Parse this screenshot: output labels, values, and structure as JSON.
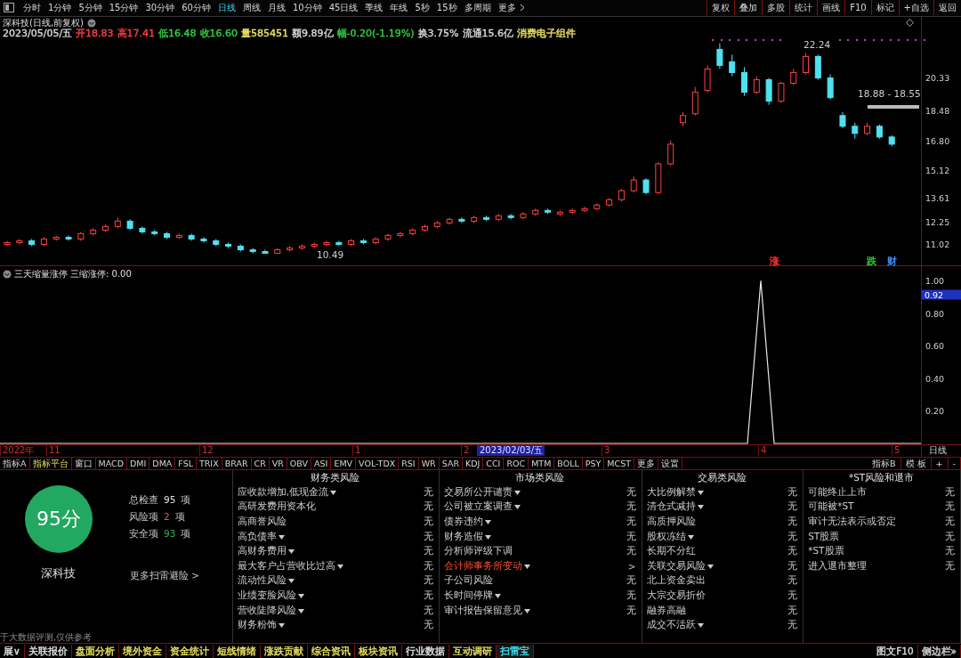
{
  "toolbar": {
    "periods": [
      {
        "label": "分时",
        "selected": false
      },
      {
        "label": "1分钟",
        "selected": false
      },
      {
        "label": "5分钟",
        "selected": false
      },
      {
        "label": "15分钟",
        "selected": false
      },
      {
        "label": "30分钟",
        "selected": false
      },
      {
        "label": "60分钟",
        "selected": false
      },
      {
        "label": "日线",
        "selected": true
      },
      {
        "label": "周线",
        "selected": false
      },
      {
        "label": "月线",
        "selected": false
      },
      {
        "label": "10分钟",
        "selected": false
      },
      {
        "label": "45日线",
        "selected": false
      },
      {
        "label": "季线",
        "selected": false
      },
      {
        "label": "年线",
        "selected": false
      },
      {
        "label": "5秒",
        "selected": false
      },
      {
        "label": "15秒",
        "selected": false
      },
      {
        "label": "多周期",
        "selected": false
      },
      {
        "label": "更多",
        "selected": false
      }
    ],
    "actions": [
      "复权",
      "叠加",
      "多股",
      "统计",
      "画线",
      "F10",
      "标记",
      "+自选",
      "返回"
    ]
  },
  "chart": {
    "title": "深科技(日线,前复权)",
    "quote": [
      {
        "text": "2023/05/05/五",
        "color": "#d8d8d8"
      },
      {
        "text": "开18.83",
        "color": "#ff4040"
      },
      {
        "text": "高17.41",
        "color": "#ff4040"
      },
      {
        "text": "低16.48",
        "color": "#30d040"
      },
      {
        "text": "收16.60",
        "color": "#30d040"
      },
      {
        "text": "量585451",
        "color": "#e8e060"
      },
      {
        "text": "额9.89亿",
        "color": "#d8d8d8"
      },
      {
        "text": "幅-0.20(-1.19%)",
        "color": "#30d040"
      },
      {
        "text": "换3.75%",
        "color": "#d8d8d8"
      },
      {
        "text": "流通15.6亿",
        "color": "#d8d8d8"
      },
      {
        "text": "消费电子组件",
        "color": "#e8e060"
      }
    ],
    "chart_data": {
      "type": "candlestick",
      "ylim": [
        9.83,
        23.71
      ],
      "yticks": [
        {
          "value": 20.33,
          "label": "20.33"
        },
        {
          "value": 18.48,
          "label": "18.48"
        },
        {
          "value": 16.8,
          "label": "16.80"
        },
        {
          "value": 15.12,
          "label": "15.12"
        },
        {
          "value": 13.61,
          "label": "13.61"
        },
        {
          "value": 12.25,
          "label": "12.25"
        },
        {
          "value": 11.02,
          "label": "11.02"
        }
      ],
      "ohlc": [
        [
          11.0,
          11.2,
          10.9,
          11.1
        ],
        [
          11.1,
          11.3,
          11.0,
          11.2
        ],
        [
          11.2,
          11.3,
          10.9,
          11.0
        ],
        [
          11.0,
          11.4,
          10.9,
          11.3
        ],
        [
          11.3,
          11.5,
          11.2,
          11.4
        ],
        [
          11.4,
          11.5,
          11.2,
          11.3
        ],
        [
          11.3,
          11.7,
          11.2,
          11.6
        ],
        [
          11.6,
          11.9,
          11.5,
          11.8
        ],
        [
          11.8,
          12.1,
          11.7,
          12.0
        ],
        [
          12.0,
          12.5,
          11.9,
          12.3
        ],
        [
          12.3,
          12.4,
          11.8,
          11.9
        ],
        [
          11.9,
          12.0,
          11.6,
          11.7
        ],
        [
          11.7,
          11.8,
          11.5,
          11.6
        ],
        [
          11.6,
          11.7,
          11.3,
          11.4
        ],
        [
          11.4,
          11.6,
          11.3,
          11.5
        ],
        [
          11.5,
          11.6,
          11.2,
          11.3
        ],
        [
          11.3,
          11.4,
          11.1,
          11.2
        ],
        [
          11.2,
          11.3,
          10.9,
          11.0
        ],
        [
          11.0,
          11.1,
          10.8,
          10.9
        ],
        [
          10.9,
          11.0,
          10.6,
          10.7
        ],
        [
          10.7,
          10.8,
          10.49,
          10.6
        ],
        [
          10.6,
          10.7,
          10.49,
          10.5
        ],
        [
          10.5,
          10.8,
          10.5,
          10.7
        ],
        [
          10.7,
          10.9,
          10.6,
          10.8
        ],
        [
          10.8,
          11.0,
          10.7,
          10.9
        ],
        [
          10.9,
          11.1,
          10.8,
          11.0
        ],
        [
          11.0,
          11.2,
          10.9,
          11.1
        ],
        [
          11.1,
          11.2,
          10.9,
          11.0
        ],
        [
          11.0,
          11.3,
          10.9,
          11.2
        ],
        [
          11.2,
          11.3,
          11.0,
          11.1
        ],
        [
          11.1,
          11.4,
          11.0,
          11.3
        ],
        [
          11.3,
          11.6,
          11.2,
          11.5
        ],
        [
          11.5,
          11.7,
          11.4,
          11.6
        ],
        [
          11.6,
          11.9,
          11.5,
          11.8
        ],
        [
          11.8,
          12.1,
          11.7,
          12.0
        ],
        [
          12.0,
          12.3,
          11.9,
          12.2
        ],
        [
          12.2,
          12.5,
          12.1,
          12.4
        ],
        [
          12.4,
          12.5,
          12.2,
          12.3
        ],
        [
          12.3,
          12.6,
          12.2,
          12.5
        ],
        [
          12.5,
          12.6,
          12.3,
          12.4
        ],
        [
          12.4,
          12.7,
          12.3,
          12.6
        ],
        [
          12.6,
          12.7,
          12.4,
          12.5
        ],
        [
          12.5,
          12.8,
          12.4,
          12.7
        ],
        [
          12.7,
          13.0,
          12.6,
          12.9
        ],
        [
          12.9,
          13.0,
          12.7,
          12.8
        ],
        [
          12.7,
          12.9,
          12.6,
          12.8
        ],
        [
          12.8,
          13.0,
          12.7,
          12.9
        ],
        [
          12.9,
          13.1,
          12.8,
          13.0
        ],
        [
          13.0,
          13.3,
          12.9,
          13.2
        ],
        [
          13.2,
          13.6,
          13.1,
          13.5
        ],
        [
          13.5,
          14.1,
          13.4,
          14.0
        ],
        [
          14.0,
          14.8,
          13.9,
          14.6
        ],
        [
          14.6,
          14.7,
          13.8,
          13.9
        ],
        [
          13.9,
          15.6,
          13.8,
          15.5
        ],
        [
          15.5,
          16.8,
          15.4,
          16.6
        ],
        [
          17.8,
          18.4,
          17.6,
          18.2
        ],
        [
          18.3,
          19.8,
          18.2,
          19.5
        ],
        [
          19.6,
          21.0,
          19.5,
          20.8
        ],
        [
          21.9,
          22.24,
          20.8,
          21.0
        ],
        [
          21.2,
          21.6,
          20.4,
          20.6
        ],
        [
          20.6,
          20.9,
          19.3,
          19.5
        ],
        [
          19.5,
          20.4,
          19.4,
          20.2
        ],
        [
          20.2,
          20.3,
          18.8,
          19.0
        ],
        [
          19.0,
          20.1,
          18.9,
          20.0
        ],
        [
          20.0,
          20.8,
          19.9,
          20.6
        ],
        [
          20.6,
          21.7,
          20.5,
          21.5
        ],
        [
          21.5,
          21.6,
          20.2,
          20.3
        ],
        [
          20.3,
          20.5,
          19.1,
          19.2
        ],
        [
          18.2,
          18.4,
          17.5,
          17.6
        ],
        [
          17.6,
          17.8,
          16.9,
          17.2
        ],
        [
          17.2,
          17.8,
          17.1,
          17.6
        ],
        [
          17.6,
          17.7,
          16.9,
          17.0
        ],
        [
          17.0,
          17.1,
          16.48,
          16.6
        ]
      ]
    },
    "high_label": "22.24",
    "low_label": "10.49",
    "range_label": "18.88 - 18.55",
    "markers": [
      {
        "text": "涨",
        "color": "#ff3030"
      },
      {
        "text": "跌",
        "color": "#30c030"
      },
      {
        "text": "财",
        "color": "#4090ff"
      }
    ]
  },
  "indicator": {
    "title": "三天缩量涨停",
    "readout": ": 0.00",
    "cursor_value": "0.92",
    "chart_data": {
      "type": "line",
      "ylim": [
        0,
        1.09
      ],
      "yticks": [
        {
          "value": 0.2,
          "label": "0.20"
        },
        {
          "value": 0.4,
          "label": "0.40"
        },
        {
          "value": 0.6,
          "label": "0.60"
        },
        {
          "value": 0.8,
          "label": "0.80"
        },
        {
          "value": 1,
          "label": "1.00"
        }
      ],
      "series": [
        {
          "name": "三缩涨停",
          "color": "#e8e8e8",
          "values": [
            0,
            0,
            0,
            0,
            0,
            0,
            0,
            0,
            0,
            0,
            0,
            0,
            0,
            0,
            0,
            0,
            0,
            0,
            0,
            0,
            0,
            0,
            0,
            0,
            0,
            0,
            0,
            0,
            0,
            0,
            0,
            0,
            0,
            0,
            0,
            0,
            0,
            0,
            0,
            0,
            0,
            0,
            0,
            0,
            0,
            0,
            0,
            0,
            0,
            0,
            0,
            0,
            0,
            0,
            0,
            0,
            0,
            1,
            0,
            0,
            0,
            0,
            0,
            0,
            0,
            0,
            0,
            0,
            0,
            0
          ]
        }
      ]
    }
  },
  "date_axis": {
    "labels": [
      {
        "text": "2022年",
        "selected": false
      },
      {
        "text": "11",
        "selected": false
      },
      {
        "text": "12",
        "selected": false
      },
      {
        "text": "1",
        "selected": false
      },
      {
        "text": "2",
        "selected": false
      },
      {
        "text": "2023/02/03/五",
        "selected": true
      },
      {
        "text": "3",
        "selected": false
      },
      {
        "text": "4",
        "selected": false
      },
      {
        "text": "5",
        "selected": false
      }
    ],
    "period": "日线"
  },
  "indicator_tabs": [
    {
      "label": "指标A",
      "selected": false
    },
    {
      "label": "指标平台",
      "selected": true
    },
    {
      "label": "窗口",
      "selected": false
    },
    {
      "label": "MACD",
      "selected": false
    },
    {
      "label": "DMI",
      "selected": false
    },
    {
      "label": "DMA",
      "selected": false
    },
    {
      "label": "FSL",
      "selected": false
    },
    {
      "label": "TRIX",
      "selected": false
    },
    {
      "label": "BRAR",
      "selected": false
    },
    {
      "label": "CR",
      "selected": false
    },
    {
      "label": "VR",
      "selected": false
    },
    {
      "label": "OBV",
      "selected": false
    },
    {
      "label": "ASI",
      "selected": false
    },
    {
      "label": "EMV",
      "selected": false
    },
    {
      "label": "VOL-TDX",
      "selected": false
    },
    {
      "label": "RSI",
      "selected": false
    },
    {
      "label": "WR",
      "selected": false
    },
    {
      "label": "SAR",
      "selected": false
    },
    {
      "label": "KDJ",
      "selected": false
    },
    {
      "label": "CCI",
      "selected": false
    },
    {
      "label": "ROC",
      "selected": false
    },
    {
      "label": "MTM",
      "selected": false
    },
    {
      "label": "BOLL",
      "selected": false
    },
    {
      "label": "PSY",
      "selected": false
    },
    {
      "label": "MCST",
      "selected": false
    },
    {
      "label": "更多",
      "selected": false
    },
    {
      "label": "设置",
      "selected": false
    }
  ],
  "indicator_tools": [
    "指标B",
    "模 板",
    "+",
    "-"
  ],
  "summary": {
    "score": "95分",
    "stock": "深科技",
    "stats": [
      {
        "label": "总检查",
        "value": "95",
        "unit": "项",
        "color": "#e0e0e0"
      },
      {
        "label": "风险项",
        "value": "2",
        "unit": "项",
        "color": "#ff5050"
      },
      {
        "label": "安全项",
        "value": "93",
        "unit": "项",
        "color": "#30b050"
      }
    ],
    "more_link": "更多扫雷避险 >",
    "disclaimer": "于大数据评测,仅供参考"
  },
  "risk_columns": [
    {
      "title": "财务类风险",
      "items": [
        {
          "label": "应收款增加,低现金流",
          "dropdown": true,
          "result": "无",
          "alert": false
        },
        {
          "label": "高研发费用资本化",
          "dropdown": false,
          "result": "无",
          "alert": false
        },
        {
          "label": "高商誉风险",
          "dropdown": false,
          "result": "无",
          "alert": false
        },
        {
          "label": "高负债率",
          "dropdown": true,
          "result": "无",
          "alert": false
        },
        {
          "label": "高财务费用",
          "dropdown": true,
          "result": "无",
          "alert": false
        },
        {
          "label": "最大客户占营收比过高",
          "dropdown": true,
          "result": "无",
          "alert": false
        },
        {
          "label": "流动性风险",
          "dropdown": true,
          "result": "无",
          "alert": false
        },
        {
          "label": "业绩变脸风险",
          "dropdown": true,
          "result": "无",
          "alert": false
        },
        {
          "label": "营收陡降风险",
          "dropdown": true,
          "result": "无",
          "alert": false
        },
        {
          "label": "财务粉饰",
          "dropdown": true,
          "result": "无",
          "alert": false
        }
      ]
    },
    {
      "title": "市场类风险",
      "items": [
        {
          "label": "交易所公开谴责",
          "dropdown": true,
          "result": "无",
          "alert": false
        },
        {
          "label": "公司被立案调查",
          "dropdown": true,
          "result": "无",
          "alert": false
        },
        {
          "label": "债券违约",
          "dropdown": true,
          "result": "无",
          "alert": false
        },
        {
          "label": "财务造假",
          "dropdown": true,
          "result": "无",
          "alert": false
        },
        {
          "label": "分析师评级下调",
          "dropdown": false,
          "result": "无",
          "alert": false
        },
        {
          "label": "会计师事务所变动",
          "dropdown": true,
          "result": ">",
          "alert": true
        },
        {
          "label": "子公司风险",
          "dropdown": false,
          "result": "无",
          "alert": false
        },
        {
          "label": "长时间停牌",
          "dropdown": true,
          "result": "无",
          "alert": false
        },
        {
          "label": "审计报告保留意见",
          "dropdown": true,
          "result": "无",
          "alert": false
        }
      ]
    },
    {
      "title": "交易类风险",
      "items": [
        {
          "label": "大比例解禁",
          "dropdown": true,
          "result": "无",
          "alert": false
        },
        {
          "label": "清仓式减持",
          "dropdown": true,
          "result": "无",
          "alert": false
        },
        {
          "label": "高质押风险",
          "dropdown": false,
          "result": "无",
          "alert": false
        },
        {
          "label": "股权冻结",
          "dropdown": true,
          "result": "无",
          "alert": false
        },
        {
          "label": "长期不分红",
          "dropdown": false,
          "result": "无",
          "alert": false
        },
        {
          "label": "关联交易风险",
          "dropdown": true,
          "result": "无",
          "alert": false
        },
        {
          "label": "北上资金卖出",
          "dropdown": false,
          "result": "无",
          "alert": false
        },
        {
          "label": "大宗交易折价",
          "dropdown": false,
          "result": "无",
          "alert": false
        },
        {
          "label": "融券高融",
          "dropdown": false,
          "result": "无",
          "alert": false
        },
        {
          "label": "成交不活跃",
          "dropdown": true,
          "result": "无",
          "alert": false
        }
      ]
    },
    {
      "title": "*ST风险和退市",
      "items": [
        {
          "label": "可能终止上市",
          "dropdown": false,
          "result": "无",
          "alert": false
        },
        {
          "label": "可能被*ST",
          "dropdown": false,
          "result": "无",
          "alert": false
        },
        {
          "label": "审计无法表示或否定",
          "dropdown": false,
          "result": "无",
          "alert": false
        },
        {
          "label": "ST股票",
          "dropdown": false,
          "result": "无",
          "alert": false
        },
        {
          "label": "*ST股票",
          "dropdown": false,
          "result": "无",
          "alert": false
        },
        {
          "label": "进入退市整理",
          "dropdown": false,
          "result": "无",
          "alert": false
        }
      ]
    }
  ],
  "bottom_tabs": [
    {
      "label": "展∨",
      "color": "#e0e0e0",
      "selected": false
    },
    {
      "label": "关联报价",
      "color": "#e0e0e0",
      "selected": false
    },
    {
      "label": "盘面分析",
      "color": "#e8e060",
      "selected": false
    },
    {
      "label": "境外资金",
      "color": "#e8e060",
      "selected": false
    },
    {
      "label": "资金统计",
      "color": "#e8e060",
      "selected": false
    },
    {
      "label": "短线情绪",
      "color": "#e8e060",
      "selected": false
    },
    {
      "label": "涨跌贡献",
      "color": "#e8e060",
      "selected": false
    },
    {
      "label": "综合资讯",
      "color": "#e8e060",
      "selected": false
    },
    {
      "label": "板块资讯",
      "color": "#e8e060",
      "selected": false
    },
    {
      "label": "行业数据",
      "color": "#e0e0e0",
      "selected": false
    },
    {
      "label": "互动调研",
      "color": "#e8e060",
      "selected": false
    },
    {
      "label": "扫雷宝",
      "color": "#40e0f0",
      "selected": true
    }
  ],
  "bottom_right": [
    "图文F10",
    "侧边栏»"
  ]
}
